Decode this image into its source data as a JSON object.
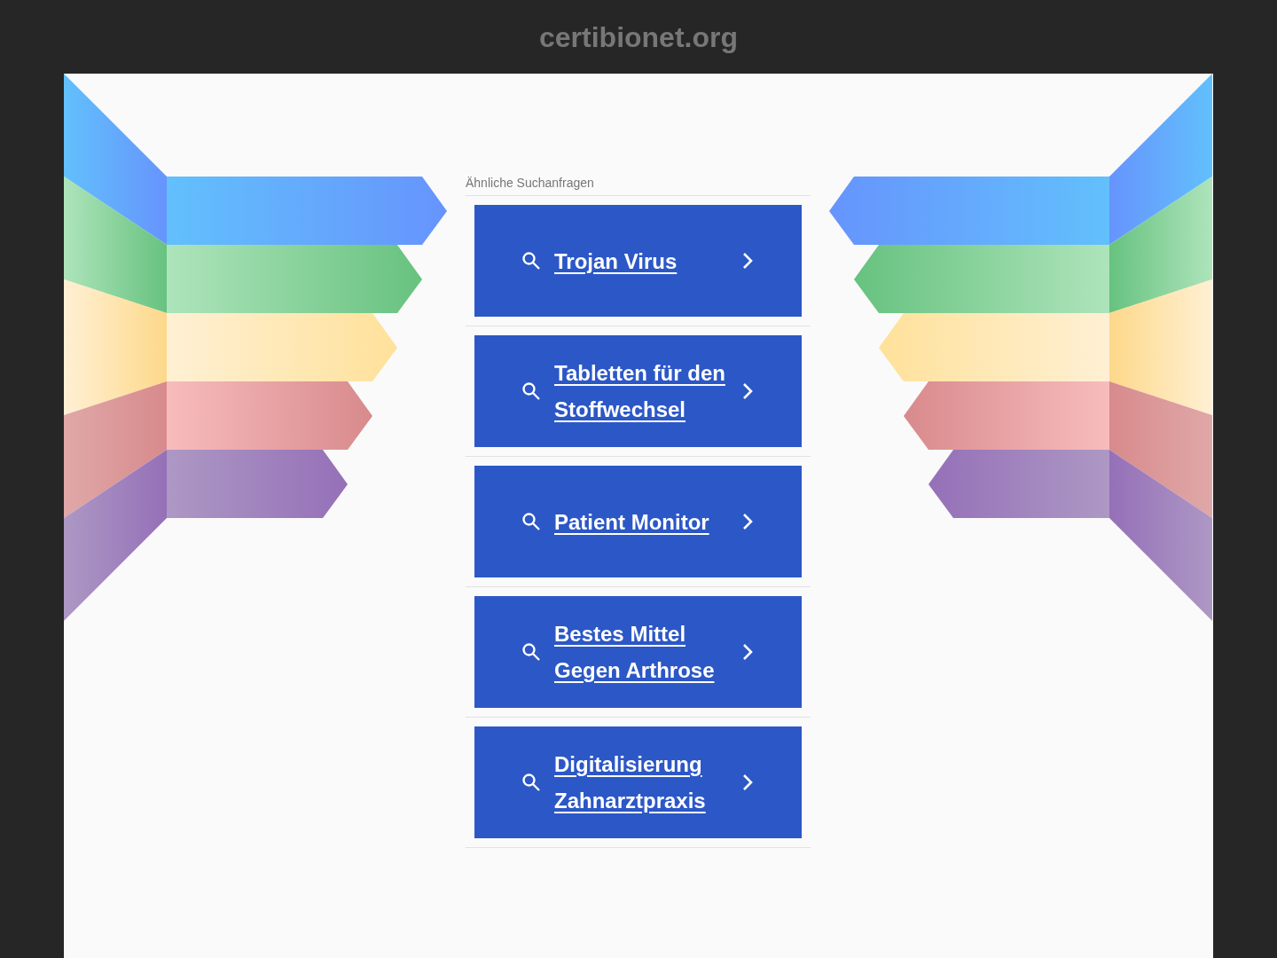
{
  "site_title": "certibionet.org",
  "section_label": "Ähnliche Suchanfragen",
  "links": [
    "Trojan Virus",
    "Tabletten für den Stoffwechsel",
    "Patient Monitor",
    "Bestes Mittel Gegen Arthrose",
    "Digitalisierung Zahnarztpraxis"
  ]
}
